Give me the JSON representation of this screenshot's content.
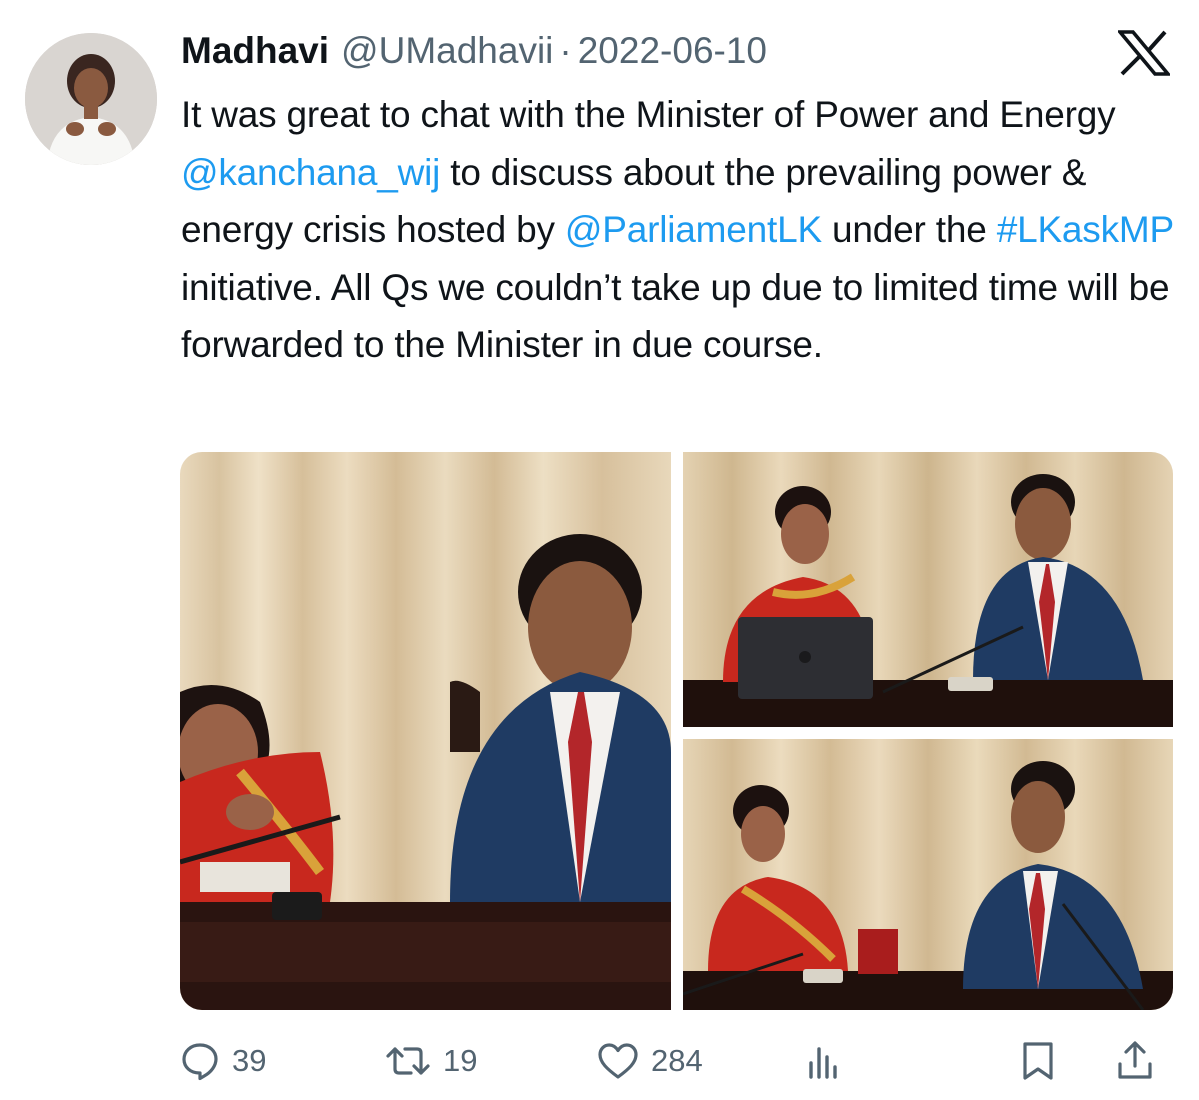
{
  "tweet": {
    "author_name": "Madhavi",
    "handle": "@UMadhavii",
    "separator": "·",
    "date": "2022-06-10",
    "text_segments": [
      {
        "text": "It was great to chat with the Minister of Power and Energy ",
        "type": "plain"
      },
      {
        "text": "@kanchana_wij",
        "type": "mention"
      },
      {
        "text": " to discuss about the prevailing power & energy crisis hosted by ",
        "type": "plain"
      },
      {
        "text": "@ParliamentLK",
        "type": "mention"
      },
      {
        "text": " under the ",
        "type": "plain"
      },
      {
        "text": "#LKaskMP",
        "type": "hashtag"
      },
      {
        "text": " initiative. All Qs we couldn’t take up due to limited time will be forwarded to the Minister in due course.",
        "type": "plain"
      }
    ]
  },
  "media": {
    "photo_count": 3
  },
  "actions": {
    "replies": "39",
    "reposts": "19",
    "likes": "284"
  },
  "icons": {
    "brand": "x-logo-icon",
    "reply": "reply-icon",
    "repost": "repost-icon",
    "like": "heart-icon",
    "views": "views-icon",
    "bookmark": "bookmark-icon",
    "share": "share-icon"
  },
  "colors": {
    "text": "#0f1419",
    "secondary": "#536471",
    "link": "#1d9bf0",
    "background": "#ffffff"
  }
}
